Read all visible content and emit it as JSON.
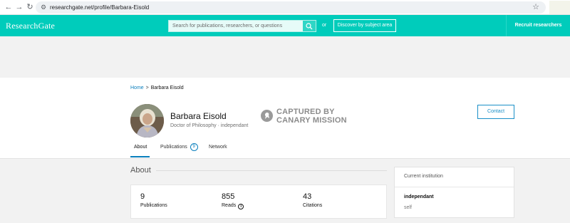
{
  "browser": {
    "url": "researchgate.net/profile/Barbara-Eisold",
    "back_glyph": "←",
    "forward_glyph": "→",
    "reload_glyph": "↻",
    "star_glyph": "☆",
    "site_info_glyph": "⚙"
  },
  "header": {
    "logo": "ResearchGate",
    "search_placeholder": "Search for publications, researchers, or questions",
    "or_label": "or",
    "discover_label": "Discover by subject area",
    "recruit_label": "Recruit researchers",
    "brand_color": "#00ccbb"
  },
  "breadcrumb": {
    "home": "Home",
    "separator": ">",
    "current": "Barbara Eisold"
  },
  "profile": {
    "name": "Barbara Eisold",
    "subtitle": "Doctor of Philosophy · independant",
    "captured_line1": "CAPTURED BY",
    "captured_line2": "CANARY MISSION",
    "contact_label": "Contact"
  },
  "tabs": {
    "about": "About",
    "publications": "Publications",
    "publications_count": "9",
    "network": "Network"
  },
  "about": {
    "heading": "About",
    "stats": [
      {
        "value": "9",
        "label": "Publications"
      },
      {
        "value": "855",
        "label": "Reads"
      },
      {
        "value": "43",
        "label": "Citations"
      }
    ],
    "info_glyph": "i"
  },
  "institution": {
    "heading": "Current institution",
    "name": "independant",
    "department": "self"
  }
}
